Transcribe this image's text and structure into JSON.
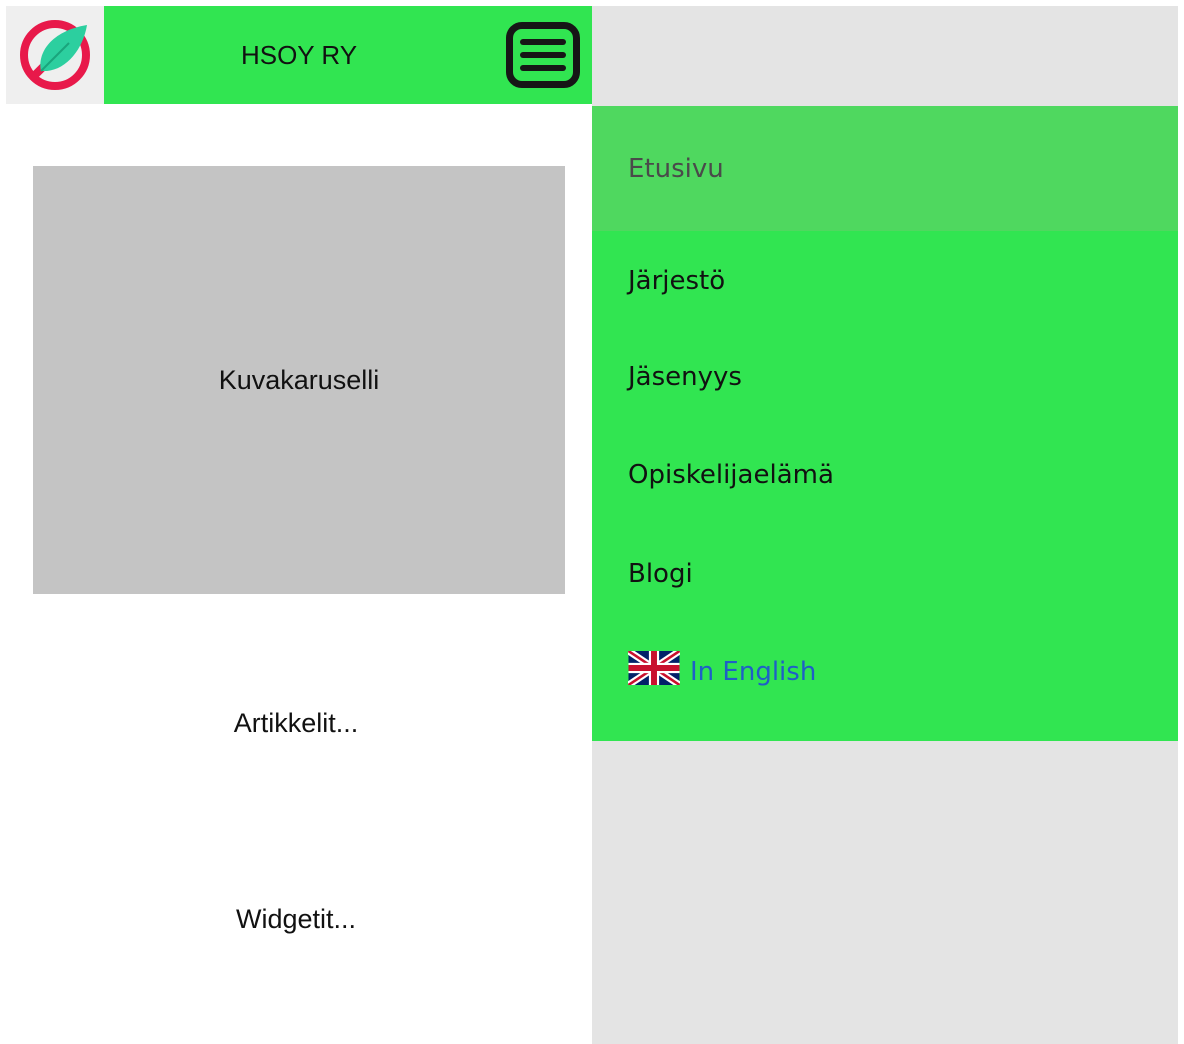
{
  "header": {
    "title": "HSOY RY",
    "logo_icon": "feather-logo-icon",
    "menu_icon": "hamburger-menu-icon",
    "accent_color": "#31e551"
  },
  "main": {
    "carousel_label": "Kuvakaruselli",
    "articles_label": "Artikkelit...",
    "widgets_label": "Widgetit..."
  },
  "nav": {
    "items": [
      {
        "label": "Etusivu",
        "active": true
      },
      {
        "label": "Järjestö"
      },
      {
        "label": "Jäsenyys"
      },
      {
        "label": "Opiskelijaelämä"
      },
      {
        "label": "Blogi"
      }
    ],
    "english": {
      "label": "In English",
      "icon": "uk-flag-icon"
    }
  }
}
